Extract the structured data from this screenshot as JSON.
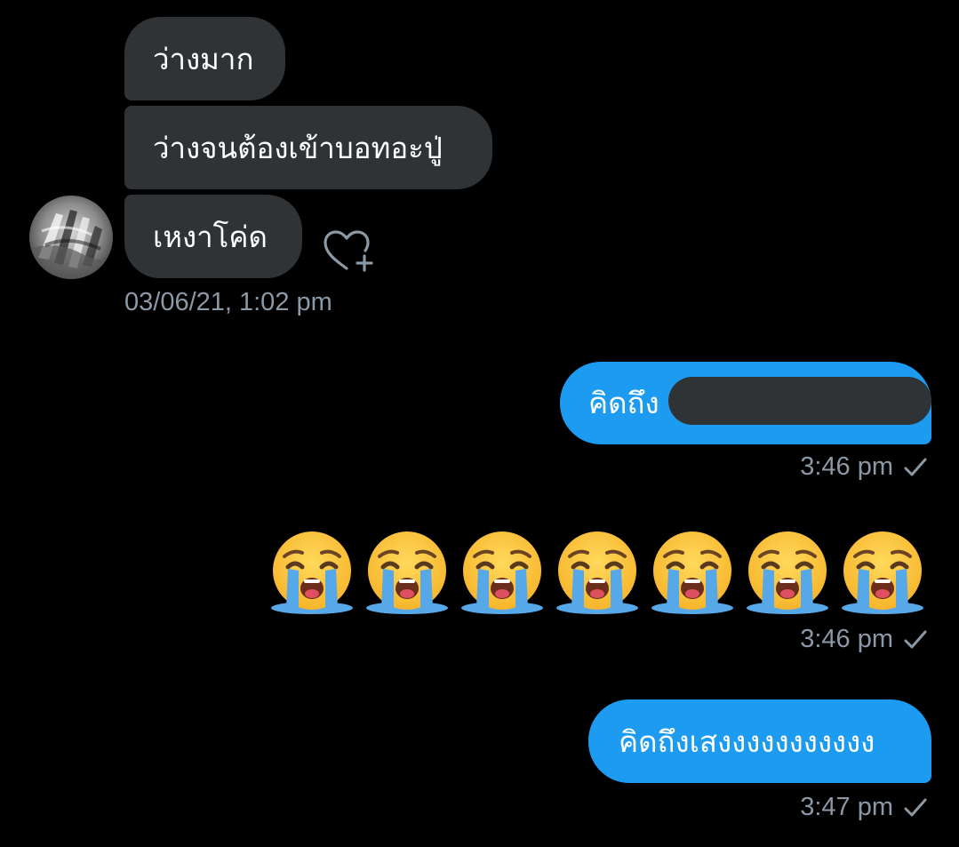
{
  "conversation": {
    "received": [
      {
        "text": "ว่างมาก"
      },
      {
        "text": "ว่างจนต้องเข้าบอทอะปู่"
      },
      {
        "text": "เหงาโค่ด"
      }
    ],
    "received_timestamp": "03/06/21, 1:02 pm",
    "sent": [
      {
        "text": "คิดถึง",
        "time": "3:46 pm",
        "redacted": true
      },
      {
        "emoji": "loudly-crying-face",
        "count": 7,
        "time": "3:46 pm"
      },
      {
        "text": "คิดถึงเสงงงงงงงงงงง",
        "time": "3:47 pm"
      }
    ]
  },
  "colors": {
    "background": "#000000",
    "received_bubble": "#2f3336",
    "sent_bubble": "#1d9bf0",
    "meta_text": "#8b98a5"
  },
  "icons": {
    "reaction": "heart-plus-icon",
    "read_receipt": "check-icon",
    "emoji": "loudly-crying-face"
  }
}
